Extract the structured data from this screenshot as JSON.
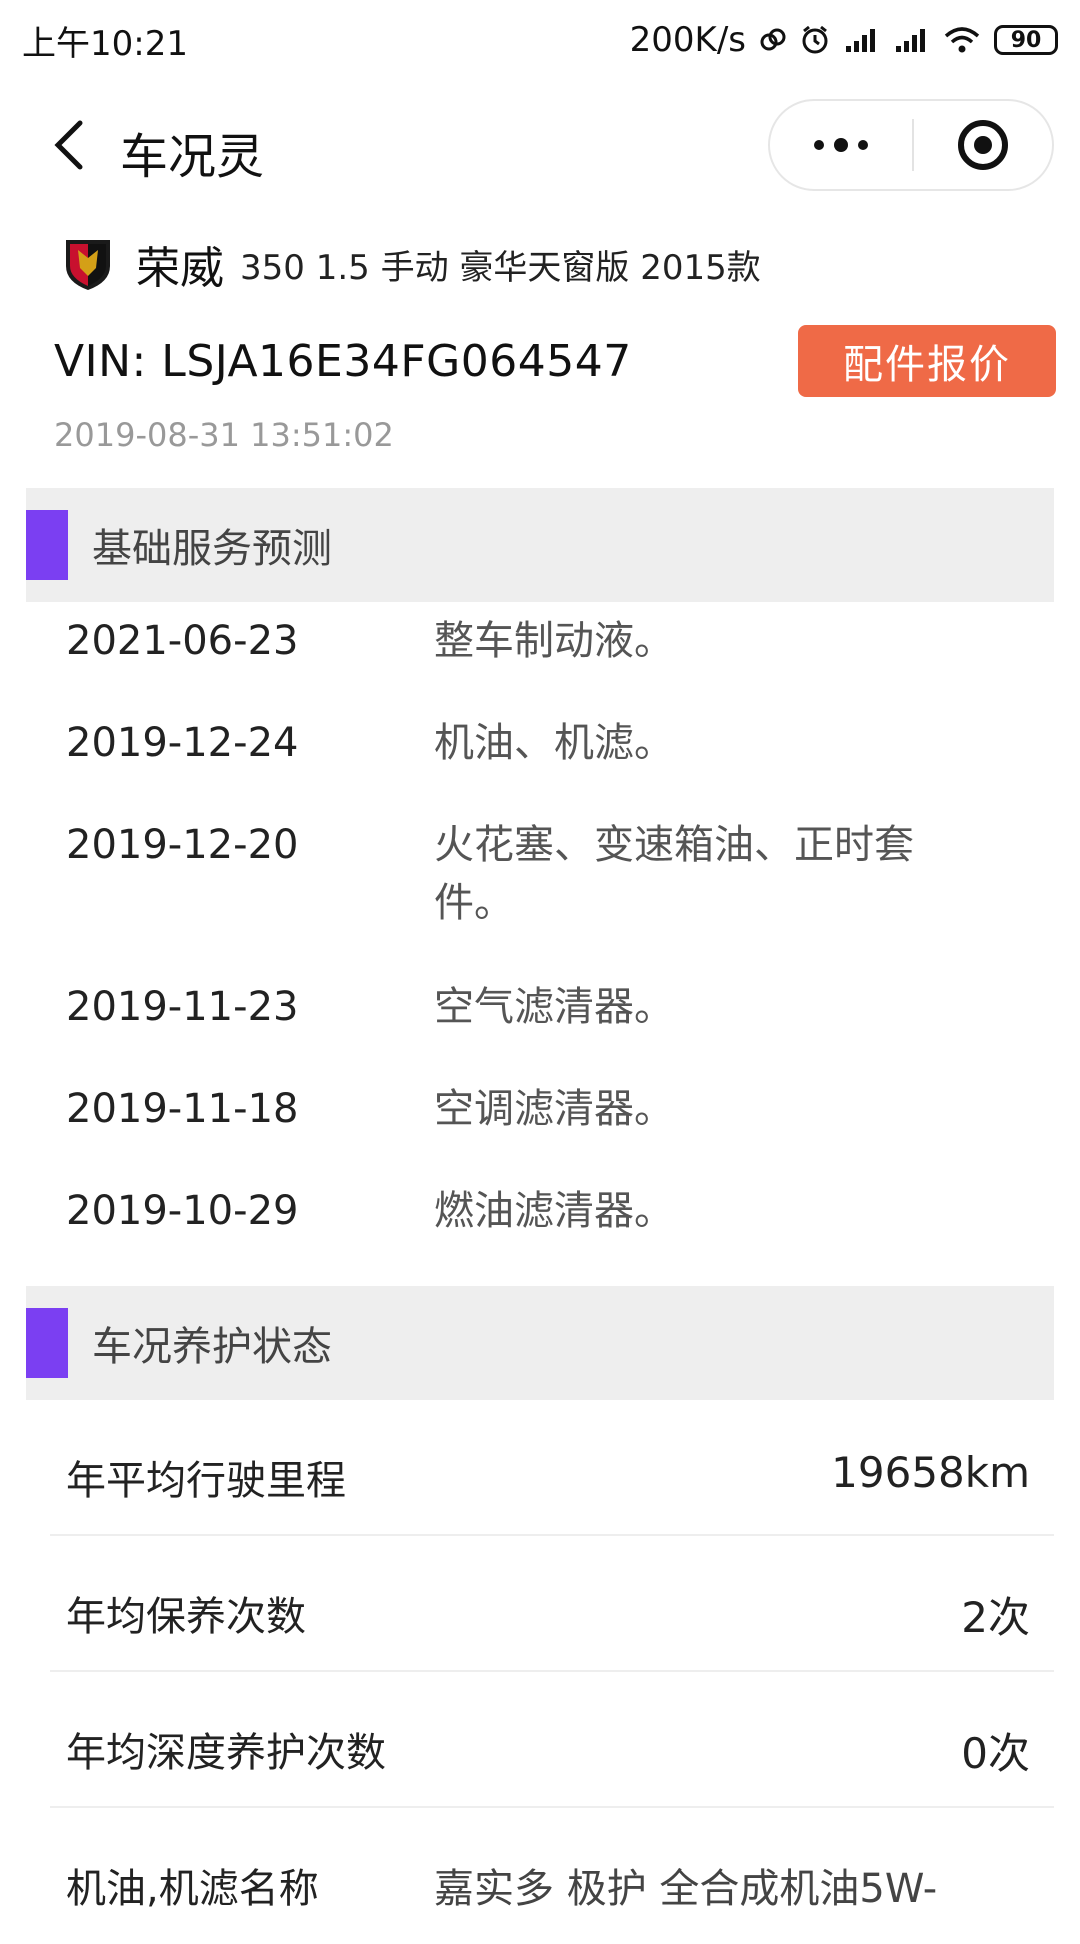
{
  "status_bar": {
    "time": "上午10:21",
    "net_speed": "200K/s",
    "battery": "90"
  },
  "title_bar": {
    "title": "车况灵"
  },
  "car": {
    "brand": "荣威",
    "model": "350 1.5 手动 豪华天窗版 2015款",
    "vin": "VIN: LSJA16E34FG064547",
    "timestamp": "2019-08-31 13:51:02",
    "quote_button": "配件报价"
  },
  "basic_service": {
    "section_title": "基础服务预测",
    "items": [
      {
        "date": "2021-06-23",
        "desc": "整车制动液。"
      },
      {
        "date": "2019-12-24",
        "desc": "机油、机滤。"
      },
      {
        "date": "2019-12-20",
        "desc": "火花塞、变速箱油、正时套件。"
      },
      {
        "date": "2019-11-23",
        "desc": "空气滤清器。"
      },
      {
        "date": "2019-11-18",
        "desc": "空调滤清器。"
      },
      {
        "date": "2019-10-29",
        "desc": "燃油滤清器。"
      }
    ]
  },
  "maintenance_status": {
    "section_title": "车况养护状态",
    "rows": [
      {
        "label": "年平均行驶里程",
        "value": "19658km"
      },
      {
        "label": "年均保养次数",
        "value": "2次"
      },
      {
        "label": "年均深度养护次数",
        "value": "0次"
      },
      {
        "label": "机油,机滤名称",
        "value": "嘉实多 极护 全合成机油5W-"
      }
    ]
  },
  "colors": {
    "accent_purple": "#7b3ff2",
    "quote_button": "#ef6a47",
    "section_bg": "#eeeeee"
  }
}
